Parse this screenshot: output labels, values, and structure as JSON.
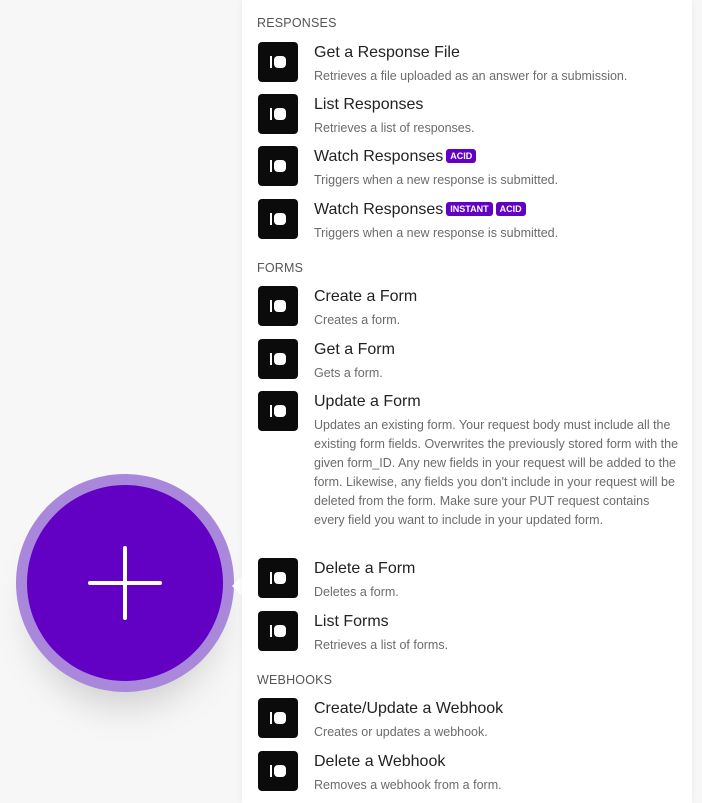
{
  "sections": [
    {
      "header": "RESPONSES",
      "items": [
        {
          "title": "Get a Response File",
          "desc": "Retrieves a file uploaded as an answer for a submission.",
          "badges": []
        },
        {
          "title": "List Responses",
          "desc": "Retrieves a list of responses.",
          "badges": []
        },
        {
          "title": "Watch Responses",
          "desc": "Triggers when a new response is submitted.",
          "badges": [
            "ACID"
          ]
        },
        {
          "title": "Watch Responses",
          "desc": "Triggers when a new response is submitted.",
          "badges": [
            "INSTANT",
            "ACID"
          ]
        }
      ]
    },
    {
      "header": "FORMS",
      "items": [
        {
          "title": "Create a Form",
          "desc": "Creates a form.",
          "badges": []
        },
        {
          "title": "Get a Form",
          "desc": "Gets a form.",
          "badges": []
        },
        {
          "title": "Update a Form",
          "desc": "Updates an existing form. Your request body must include all the existing form fields. Overwrites the previously stored form with the given form_ID. Any new fields in your request will be added to the form. Likewise, any fields you don't include in your request will be deleted from the form. Make sure your PUT request contains every field you want to include in your updated form.",
          "badges": []
        },
        {
          "title": "Delete a Form",
          "desc": "Deletes a form.",
          "badges": []
        },
        {
          "title": "List Forms",
          "desc": "Retrieves a list of forms.",
          "badges": []
        }
      ]
    },
    {
      "header": "WEBHOOKS",
      "items": [
        {
          "title": "Create/Update a Webhook",
          "desc": "Creates or updates a webhook.",
          "badges": []
        },
        {
          "title": "Delete a Webhook",
          "desc": "Removes a webhook from a form.",
          "badges": []
        }
      ]
    }
  ],
  "icons": {
    "item_icon": "typeform-icon",
    "add": "plus-icon"
  },
  "colors": {
    "accent": "#6200c3",
    "ring": "#a987da",
    "icon_bg": "#0b0b0b"
  }
}
